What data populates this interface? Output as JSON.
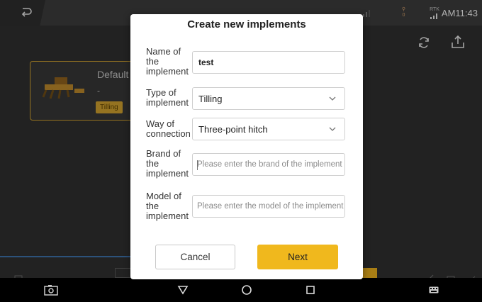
{
  "status_bar": {
    "time": "AM11:43",
    "rtk_label": "RTK",
    "gps_label": "0"
  },
  "implement_card": {
    "name": "Default",
    "subtitle": "-",
    "type_tag": "Tilling"
  },
  "dialog": {
    "title": "Create new implements",
    "fields": [
      {
        "label": "Name of the implement",
        "value": "test",
        "placeholder": ""
      },
      {
        "label": "Type of implement",
        "value": "Tilling",
        "placeholder": ""
      },
      {
        "label": "Way of connection",
        "value": "Three-point hitch",
        "placeholder": ""
      },
      {
        "label": "Brand of the implement",
        "value": "",
        "placeholder": "Please enter the brand of the implement"
      },
      {
        "label": "Model of the implement",
        "value": "",
        "placeholder": "Please enter the model of the implement"
      }
    ],
    "cancel_label": "Cancel",
    "next_label": "Next"
  },
  "colors": {
    "accent": "#f0b81d",
    "card_border": "#c79a2c",
    "background": "#2e2e2e"
  },
  "icons": [
    "back-icon",
    "signal-icon",
    "gps-icon",
    "rtk-icon",
    "refresh-icon",
    "upload-icon",
    "chevron-down-icon",
    "screenshot-icon",
    "nav-back-icon",
    "nav-home-icon",
    "nav-recents-icon",
    "keyboard-icon"
  ]
}
